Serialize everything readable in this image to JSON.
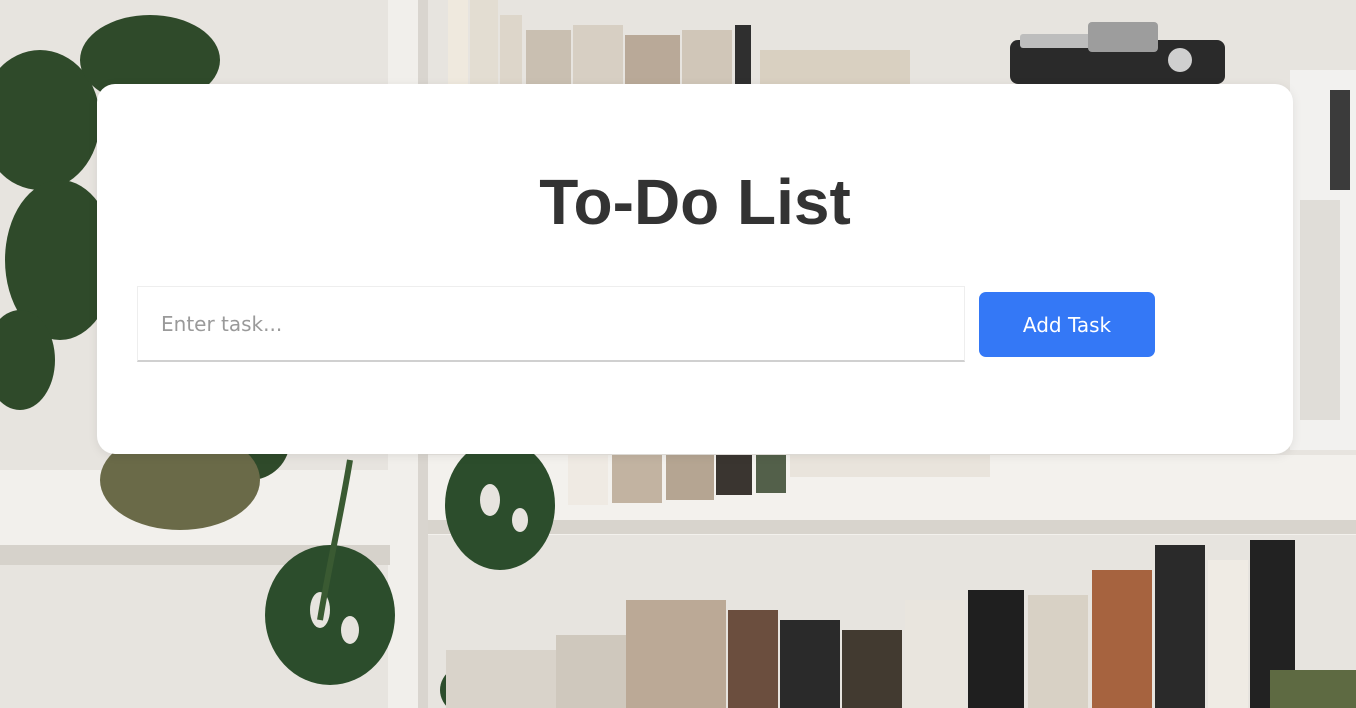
{
  "app": {
    "title": "To-Do List"
  },
  "task_input": {
    "value": "",
    "placeholder": "Enter task..."
  },
  "add_button": {
    "label": "Add Task"
  },
  "colors": {
    "button_background": "#3478f6",
    "title_text": "#333333",
    "card_background": "#ffffff"
  },
  "background": {
    "description_icon": "bookshelf-photo"
  }
}
